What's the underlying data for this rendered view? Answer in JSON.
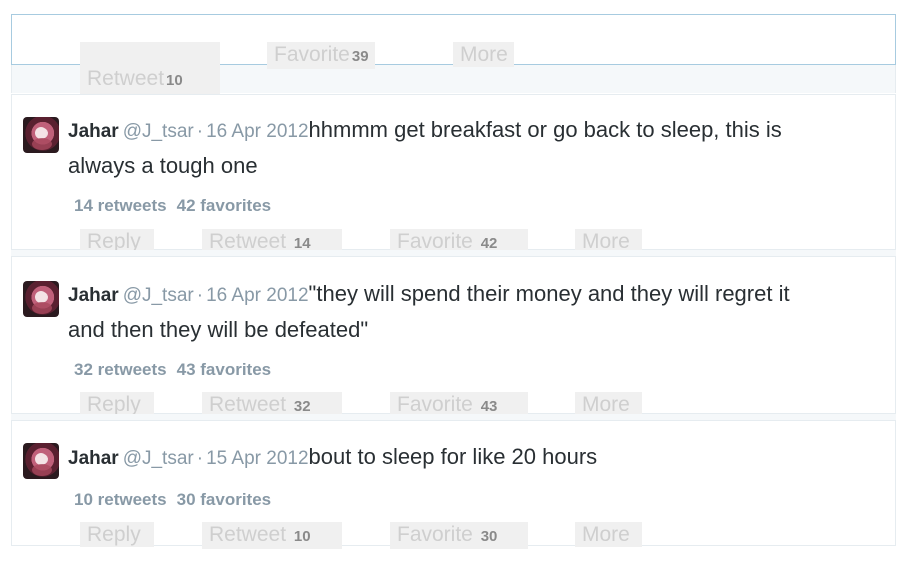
{
  "top_actions": {
    "retweet_label": "Retweet",
    "retweet_count": "10",
    "favorite_label": "Favorite",
    "favorite_count": "39",
    "more_label": "More"
  },
  "tweets": [
    {
      "name": "Jahar",
      "handle": "@J_tsar",
      "separator": "·",
      "date": "16 Apr 2012",
      "text_line1": "hhmmm get breakfast or go back to sleep, this is",
      "text_line2": "always a tough one",
      "retweets_stat": "14 retweets",
      "favorites_stat": "42 favorites",
      "reply_label": "Reply",
      "retweet_label": "Retweet",
      "retweet_count": "14",
      "favorite_label": "Favorite",
      "favorite_count": "42",
      "more_label": "More"
    },
    {
      "name": "Jahar",
      "handle": "@J_tsar",
      "separator": "·",
      "date": "16 Apr 2012",
      "text_line1": "\"they will spend their money and they will regret it",
      "text_line2": "and then they will be defeated\"",
      "retweets_stat": "32 retweets",
      "favorites_stat": "43 favorites",
      "reply_label": "Reply",
      "retweet_label": "Retweet",
      "retweet_count": "32",
      "favorite_label": "Favorite",
      "favorite_count": "43",
      "more_label": "More"
    },
    {
      "name": "Jahar",
      "handle": "@J_tsar",
      "separator": "·",
      "date": "15 Apr 2012",
      "text_line1": "bout to sleep for like 20 hours",
      "text_line2": "",
      "retweets_stat": "10 retweets",
      "favorites_stat": "30 favorites",
      "reply_label": "Reply",
      "retweet_label": "Retweet",
      "retweet_count": "10",
      "favorite_label": "Favorite",
      "favorite_count": "30",
      "more_label": "More"
    }
  ]
}
